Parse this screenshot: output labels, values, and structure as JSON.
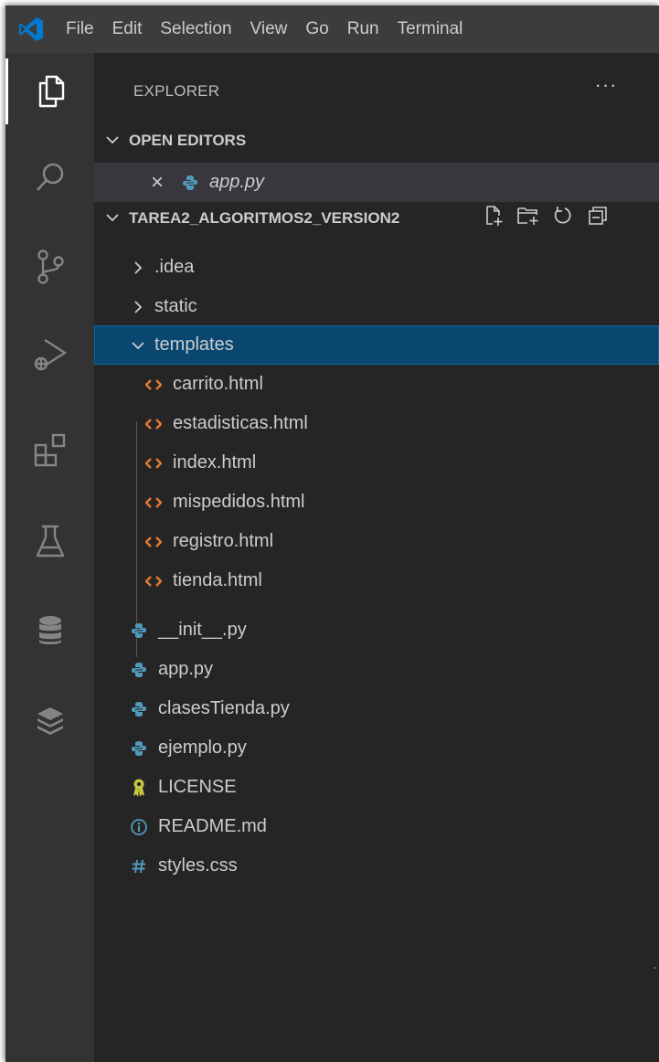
{
  "menu": {
    "items": [
      "File",
      "Edit",
      "Selection",
      "View",
      "Go",
      "Run",
      "Terminal"
    ]
  },
  "activity_bar": {
    "icons": [
      "explorer-icon",
      "search-icon",
      "source-control-icon",
      "run-debug-icon",
      "extensions-icon",
      "testing-icon",
      "database-icon",
      "stack-icon"
    ]
  },
  "sidebar": {
    "title": "EXPLORER",
    "more": "···",
    "open_editors": {
      "header": "OPEN EDITORS",
      "items": [
        {
          "label": "app.py",
          "close": "×"
        }
      ]
    },
    "folder": {
      "header": "TAREA2_ALGORITMOS2_VERSION2",
      "entries": [
        {
          "label": ".idea",
          "type": "folder-collapsed"
        },
        {
          "label": "static",
          "type": "folder-collapsed"
        },
        {
          "label": "templates",
          "type": "folder-expanded"
        },
        {
          "label": "carrito.html",
          "type": "html"
        },
        {
          "label": "estadisticas.html",
          "type": "html"
        },
        {
          "label": "index.html",
          "type": "html"
        },
        {
          "label": "mispedidos.html",
          "type": "html"
        },
        {
          "label": "registro.html",
          "type": "html"
        },
        {
          "label": "tienda.html",
          "type": "html"
        },
        {
          "label": "__init__.py",
          "type": "python"
        },
        {
          "label": "app.py",
          "type": "python"
        },
        {
          "label": "clasesTienda.py",
          "type": "python"
        },
        {
          "label": "ejemplo.py",
          "type": "python"
        },
        {
          "label": "LICENSE",
          "type": "license"
        },
        {
          "label": "README.md",
          "type": "info"
        },
        {
          "label": "styles.css",
          "type": "css"
        }
      ]
    }
  },
  "colors": {
    "accent": "#0e639c",
    "selection": "#094771",
    "html_icon": "#e37933",
    "python_icon": "#519aba",
    "license_icon": "#cbcb41"
  }
}
